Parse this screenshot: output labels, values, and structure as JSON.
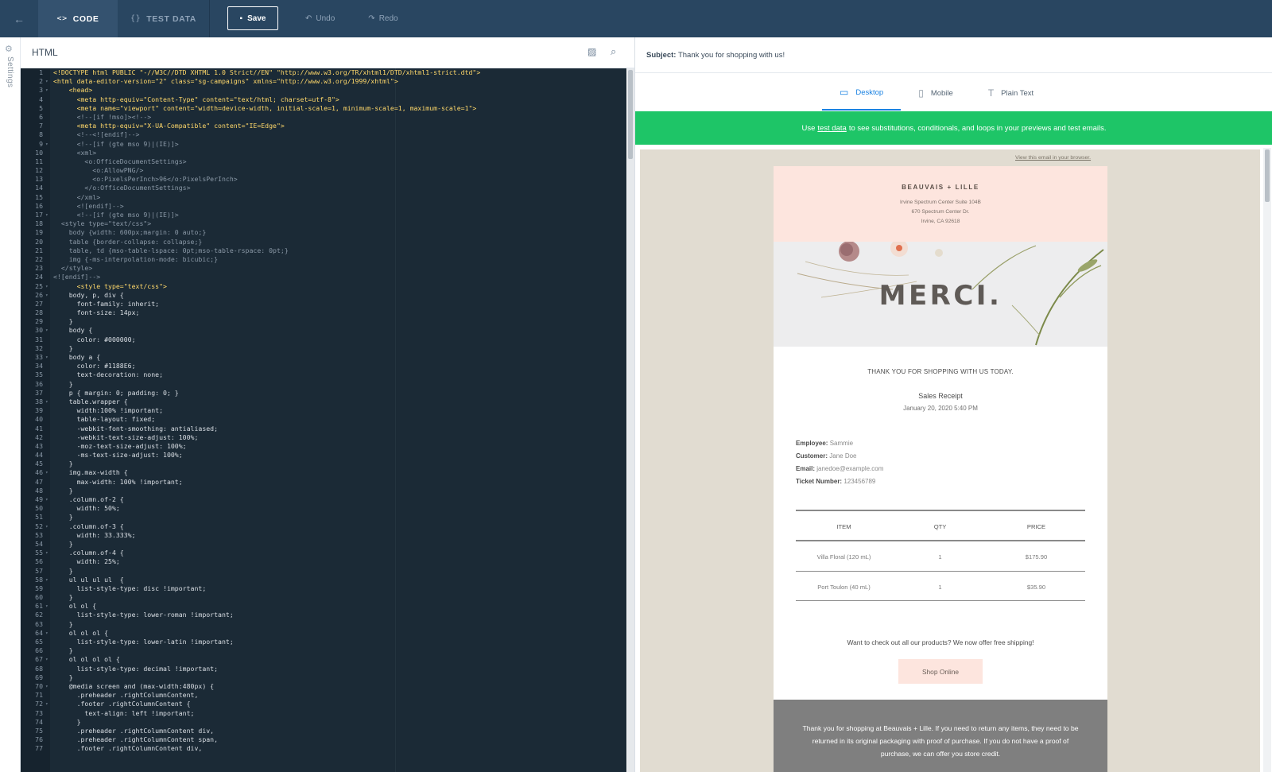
{
  "toolbar": {
    "back_icon": "arrow-left-icon",
    "tabs": [
      {
        "label": "CODE",
        "icon": "<>"
      },
      {
        "label": "TEST DATA",
        "icon": "{}"
      }
    ],
    "save_label": "Save",
    "undo_label": "Undo",
    "redo_label": "Redo"
  },
  "rail": {
    "label": "Settings"
  },
  "editor": {
    "title": "HTML",
    "lines": [
      {
        "n": "1",
        "fold": "",
        "cls": "c-tag",
        "t": "<!DOCTYPE html PUBLIC \"-//W3C//DTD XHTML 1.0 Strict//EN\" \"http://www.w3.org/TR/xhtml1/DTD/xhtml1-strict.dtd\">"
      },
      {
        "n": "2",
        "fold": "▾",
        "cls": "c-tag",
        "t": "<html data-editor-version=\"2\" class=\"sg-campaigns\" xmlns=\"http://www.w3.org/1999/xhtml\">"
      },
      {
        "n": "3",
        "fold": "▾",
        "cls": "c-tag",
        "t": "    <head>"
      },
      {
        "n": "4",
        "fold": "",
        "cls": "c-tag",
        "t": "      <meta http-equiv=\"Content-Type\" content=\"text/html; charset=utf-8\">"
      },
      {
        "n": "5",
        "fold": "",
        "cls": "c-tag",
        "t": "      <meta name=\"viewport\" content=\"width=device-width, initial-scale=1, minimum-scale=1, maximum-scale=1\">"
      },
      {
        "n": "6",
        "fold": "",
        "cls": "c-com",
        "t": "      <!--[if !mso]><!-->"
      },
      {
        "n": "7",
        "fold": "",
        "cls": "c-tag",
        "t": "      <meta http-equiv=\"X-UA-Compatible\" content=\"IE=Edge\">"
      },
      {
        "n": "8",
        "fold": "",
        "cls": "c-com",
        "t": "      <!--<![endif]-->"
      },
      {
        "n": "9",
        "fold": "▾",
        "cls": "c-com",
        "t": "      <!--[if (gte mso 9)|(IE)]>"
      },
      {
        "n": "10",
        "fold": "",
        "cls": "c-com",
        "t": "      <xml>"
      },
      {
        "n": "11",
        "fold": "",
        "cls": "c-com",
        "t": "        <o:OfficeDocumentSettings>"
      },
      {
        "n": "12",
        "fold": "",
        "cls": "c-com",
        "t": "          <o:AllowPNG/>"
      },
      {
        "n": "13",
        "fold": "",
        "cls": "c-com",
        "t": "          <o:PixelsPerInch>96</o:PixelsPerInch>"
      },
      {
        "n": "14",
        "fold": "",
        "cls": "c-com",
        "t": "        </o:OfficeDocumentSettings>"
      },
      {
        "n": "15",
        "fold": "",
        "cls": "c-com",
        "t": "      </xml>"
      },
      {
        "n": "16",
        "fold": "",
        "cls": "c-com",
        "t": "      <![endif]-->"
      },
      {
        "n": "17",
        "fold": "▾",
        "cls": "c-com",
        "t": "      <!--[if (gte mso 9)|(IE)]>"
      },
      {
        "n": "18",
        "fold": "",
        "cls": "c-com",
        "t": "  <style type=\"text/css\">"
      },
      {
        "n": "19",
        "fold": "",
        "cls": "c-com",
        "t": "    body {width: 600px;margin: 0 auto;}"
      },
      {
        "n": "20",
        "fold": "",
        "cls": "c-com",
        "t": "    table {border-collapse: collapse;}"
      },
      {
        "n": "21",
        "fold": "",
        "cls": "c-com",
        "t": "    table, td {mso-table-lspace: 0pt;mso-table-rspace: 0pt;}"
      },
      {
        "n": "22",
        "fold": "",
        "cls": "c-com",
        "t": "    img {-ms-interpolation-mode: bicubic;}"
      },
      {
        "n": "23",
        "fold": "",
        "cls": "c-com",
        "t": "  </style>"
      },
      {
        "n": "24",
        "fold": "",
        "cls": "c-com",
        "t": "<![endif]-->"
      },
      {
        "n": "25",
        "fold": "▾",
        "cls": "c-tag",
        "t": "      <style type=\"text/css\">"
      },
      {
        "n": "26",
        "fold": "▾",
        "cls": "c-def",
        "t": "    body, p, div {"
      },
      {
        "n": "27",
        "fold": "",
        "cls": "c-def",
        "t": "      font-family: inherit;"
      },
      {
        "n": "28",
        "fold": "",
        "cls": "c-def",
        "t": "      font-size: 14px;"
      },
      {
        "n": "29",
        "fold": "",
        "cls": "c-def",
        "t": "    }"
      },
      {
        "n": "30",
        "fold": "▾",
        "cls": "c-def",
        "t": "    body {"
      },
      {
        "n": "31",
        "fold": "",
        "cls": "c-def",
        "t": "      color: #000000;"
      },
      {
        "n": "32",
        "fold": "",
        "cls": "c-def",
        "t": "    }"
      },
      {
        "n": "33",
        "fold": "▾",
        "cls": "c-def",
        "t": "    body a {"
      },
      {
        "n": "34",
        "fold": "",
        "cls": "c-def",
        "t": "      color: #1188E6;"
      },
      {
        "n": "35",
        "fold": "",
        "cls": "c-def",
        "t": "      text-decoration: none;"
      },
      {
        "n": "36",
        "fold": "",
        "cls": "c-def",
        "t": "    }"
      },
      {
        "n": "37",
        "fold": "",
        "cls": "c-def",
        "t": "    p { margin: 0; padding: 0; }"
      },
      {
        "n": "38",
        "fold": "▾",
        "cls": "c-def",
        "t": "    table.wrapper {"
      },
      {
        "n": "39",
        "fold": "",
        "cls": "c-def",
        "t": "      width:100% !important;"
      },
      {
        "n": "40",
        "fold": "",
        "cls": "c-def",
        "t": "      table-layout: fixed;"
      },
      {
        "n": "41",
        "fold": "",
        "cls": "c-def",
        "t": "      -webkit-font-smoothing: antialiased;"
      },
      {
        "n": "42",
        "fold": "",
        "cls": "c-def",
        "t": "      -webkit-text-size-adjust: 100%;"
      },
      {
        "n": "43",
        "fold": "",
        "cls": "c-def",
        "t": "      -moz-text-size-adjust: 100%;"
      },
      {
        "n": "44",
        "fold": "",
        "cls": "c-def",
        "t": "      -ms-text-size-adjust: 100%;"
      },
      {
        "n": "45",
        "fold": "",
        "cls": "c-def",
        "t": "    }"
      },
      {
        "n": "46",
        "fold": "▾",
        "cls": "c-def",
        "t": "    img.max-width {"
      },
      {
        "n": "47",
        "fold": "",
        "cls": "c-def",
        "t": "      max-width: 100% !important;"
      },
      {
        "n": "48",
        "fold": "",
        "cls": "c-def",
        "t": "    }"
      },
      {
        "n": "49",
        "fold": "▾",
        "cls": "c-def",
        "t": "    .column.of-2 {"
      },
      {
        "n": "50",
        "fold": "",
        "cls": "c-def",
        "t": "      width: 50%;"
      },
      {
        "n": "51",
        "fold": "",
        "cls": "c-def",
        "t": "    }"
      },
      {
        "n": "52",
        "fold": "▾",
        "cls": "c-def",
        "t": "    .column.of-3 {"
      },
      {
        "n": "53",
        "fold": "",
        "cls": "c-def",
        "t": "      width: 33.333%;"
      },
      {
        "n": "54",
        "fold": "",
        "cls": "c-def",
        "t": "    }"
      },
      {
        "n": "55",
        "fold": "▾",
        "cls": "c-def",
        "t": "    .column.of-4 {"
      },
      {
        "n": "56",
        "fold": "",
        "cls": "c-def",
        "t": "      width: 25%;"
      },
      {
        "n": "57",
        "fold": "",
        "cls": "c-def",
        "t": "    }"
      },
      {
        "n": "58",
        "fold": "▾",
        "cls": "c-def",
        "t": "    ul ul ul ul  {"
      },
      {
        "n": "59",
        "fold": "",
        "cls": "c-def",
        "t": "      list-style-type: disc !important;"
      },
      {
        "n": "60",
        "fold": "",
        "cls": "c-def",
        "t": "    }"
      },
      {
        "n": "61",
        "fold": "▾",
        "cls": "c-def",
        "t": "    ol ol {"
      },
      {
        "n": "62",
        "fold": "",
        "cls": "c-def",
        "t": "      list-style-type: lower-roman !important;"
      },
      {
        "n": "63",
        "fold": "",
        "cls": "c-def",
        "t": "    }"
      },
      {
        "n": "64",
        "fold": "▾",
        "cls": "c-def",
        "t": "    ol ol ol {"
      },
      {
        "n": "65",
        "fold": "",
        "cls": "c-def",
        "t": "      list-style-type: lower-latin !important;"
      },
      {
        "n": "66",
        "fold": "",
        "cls": "c-def",
        "t": "    }"
      },
      {
        "n": "67",
        "fold": "▾",
        "cls": "c-def",
        "t": "    ol ol ol ol {"
      },
      {
        "n": "68",
        "fold": "",
        "cls": "c-def",
        "t": "      list-style-type: decimal !important;"
      },
      {
        "n": "69",
        "fold": "",
        "cls": "c-def",
        "t": "    }"
      },
      {
        "n": "70",
        "fold": "▾",
        "cls": "c-def",
        "t": "    @media screen and (max-width:480px) {"
      },
      {
        "n": "71",
        "fold": "",
        "cls": "c-def",
        "t": "      .preheader .rightColumnContent,"
      },
      {
        "n": "72",
        "fold": "▾",
        "cls": "c-def",
        "t": "      .footer .rightColumnContent {"
      },
      {
        "n": "73",
        "fold": "",
        "cls": "c-def",
        "t": "        text-align: left !important;"
      },
      {
        "n": "74",
        "fold": "",
        "cls": "c-def",
        "t": "      }"
      },
      {
        "n": "75",
        "fold": "",
        "cls": "c-def",
        "t": "      .preheader .rightColumnContent div,"
      },
      {
        "n": "76",
        "fold": "",
        "cls": "c-def",
        "t": "      .preheader .rightColumnContent span,"
      },
      {
        "n": "77",
        "fold": "",
        "cls": "c-def",
        "t": "      .footer .rightColumnContent div,"
      }
    ]
  },
  "preview": {
    "subject_label": "Subject:",
    "subject_value": "Thank you for shopping with us!",
    "tabs": [
      {
        "label": "Desktop",
        "icon": "desktop-icon"
      },
      {
        "label": "Mobile",
        "icon": "mobile-icon"
      },
      {
        "label": "Plain Text",
        "icon": "text-icon"
      }
    ],
    "banner_pre": "Use",
    "banner_link": "test data",
    "banner_post": "to see substitutions, conditionals, and loops in your previews and test emails.",
    "view_in_browser": "View this email in your browser."
  },
  "email": {
    "brand": "BEAUVAIS + LILLE",
    "address": [
      "Irvine Spectrum Center Suite 104B",
      "670 Spectrum Center Dr.",
      "Irvine, CA 92618"
    ],
    "hero_text": "MERCI.",
    "thanks": "THANK YOU FOR SHOPPING WITH US TODAY.",
    "receipt_title": "Sales Receipt",
    "receipt_date": "January 20, 2020 5:40 PM",
    "info": [
      {
        "label": "Employee:",
        "value": "Sammie"
      },
      {
        "label": "Customer:",
        "value": "Jane Doe"
      },
      {
        "label": "Email:",
        "value": "janedoe@example.com"
      },
      {
        "label": "Ticket Number:",
        "value": "123456789"
      }
    ],
    "table_headers": [
      "ITEM",
      "QTY",
      "PRICE"
    ],
    "rows": [
      [
        "Villa Floral (120 mL)",
        "1",
        "$175.90"
      ],
      [
        "Port Toulon (40 mL)",
        "1",
        "$35.90"
      ]
    ],
    "shop_text": "Want to check out all our products? We now offer free shipping!",
    "shop_button": "Shop Online",
    "footer_lines": [
      "Thank you for shopping at Beauvais + Lille. If you need to return any items, they need to be",
      "returned in its original packaging with proof of purchase. If you do not have a proof of",
      "purchase, we can offer you store credit."
    ]
  },
  "colors": {
    "topbar": "#294661",
    "accent": "#1a82e2",
    "banner": "#1ec567",
    "email_header": "#fde5de",
    "footer": "#7f7f7f"
  }
}
